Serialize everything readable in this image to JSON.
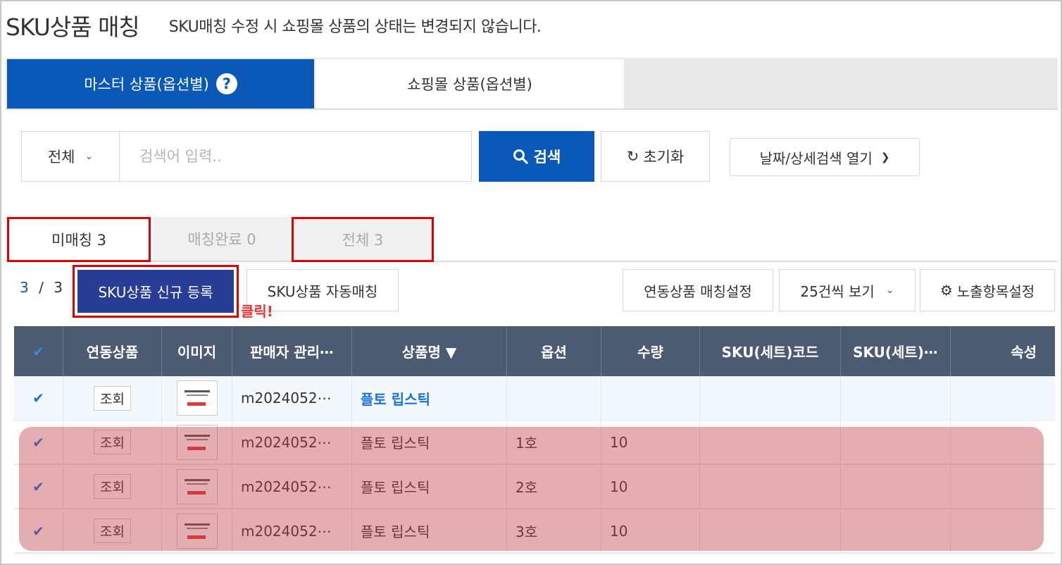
{
  "header": {
    "title": "SKU상품 매칭",
    "description": "SKU매칭 수정 시 쇼핑몰 상품의 상태는 변경되지 않습니다."
  },
  "main_tabs": [
    {
      "label": "마스터 상품(옵션별)",
      "active": true
    },
    {
      "label": "쇼핑몰 상품(옵션별)",
      "active": false
    }
  ],
  "search": {
    "scope": "전체",
    "placeholder": "검색어 입력..",
    "value": "",
    "search_label": "검색",
    "reset_label": "초기화",
    "detail_label": "날짜/상세검색 열기"
  },
  "status_tabs": [
    {
      "label": "미매칭 3",
      "active": true
    },
    {
      "label": "매칭완료 0",
      "active": false
    },
    {
      "label": "전체 3",
      "active": false
    }
  ],
  "toolbar": {
    "current": "3",
    "separator": "/",
    "total": "3",
    "new_label": "SKU상품 신규 등록",
    "click_hint": "클릭!",
    "auto_label": "SKU상품 자동매칭",
    "link_setting_label": "연동상품 매칭설정",
    "page_size_label": "25건씩 보기",
    "columns_label": "노출항목설정"
  },
  "table": {
    "headers": [
      "✔",
      "연동상품",
      "이미지",
      "판매자 관리⋯",
      "상품명 ▼",
      "옵션",
      "수량",
      "SKU(세트)코드",
      "SKU(세트)⋯",
      "속성"
    ],
    "rows": [
      {
        "view": "조회",
        "code": "m2024052⋯",
        "name": "플토 립스틱",
        "option": "",
        "qty": ""
      },
      {
        "view": "조회",
        "code": "m2024052⋯",
        "name": "플토 립스틱",
        "option": "1호",
        "qty": "10"
      },
      {
        "view": "조회",
        "code": "m2024052⋯",
        "name": "플토 립스틱",
        "option": "2호",
        "qty": "10"
      },
      {
        "view": "조회",
        "code": "m2024052⋯",
        "name": "플토 립스틱",
        "option": "3호",
        "qty": "10"
      }
    ]
  },
  "colors": {
    "primary_blue": "#0a58b8",
    "new_button": "#283d96",
    "table_header": "#4a5b72",
    "highlight_red": "#e00000",
    "click_text": "#e83535",
    "overlay": "#be3c46"
  }
}
